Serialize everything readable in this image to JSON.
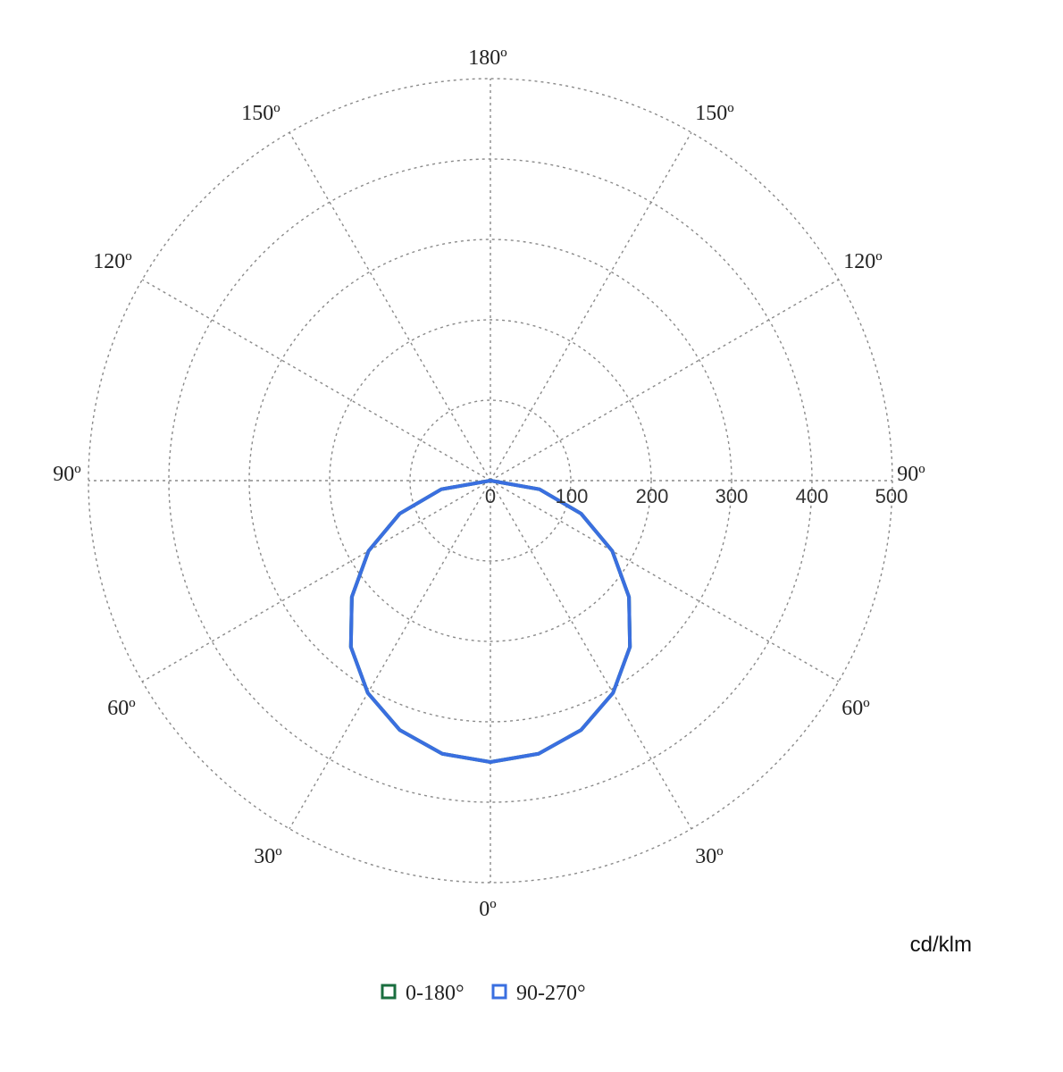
{
  "chart_data": {
    "type": "polar-line",
    "unit_label": "cd/klm",
    "radial_axis": {
      "range": [
        0,
        500
      ],
      "ticks": [
        "0",
        "100",
        "200",
        "300",
        "400",
        "500"
      ]
    },
    "angle_labels": {
      "top": "180º",
      "bottom": "0º",
      "left": "90º",
      "right": "90º",
      "left_upper": [
        "150º",
        "120º"
      ],
      "right_upper": [
        "150º",
        "120º"
      ],
      "left_lower": [
        "60º",
        "30º"
      ],
      "right_lower": [
        "60º",
        "30º"
      ]
    },
    "grid": true,
    "legend_position": "bottom-center",
    "series": [
      {
        "name": "0-180°",
        "color": "#1a6e3f",
        "angles": [
          0,
          10,
          20,
          30,
          40,
          50,
          60,
          70,
          80,
          90
        ],
        "values": [
          350,
          345,
          330,
          305,
          270,
          225,
          175,
          120,
          62,
          0
        ]
      },
      {
        "name": "90-270°",
        "color": "#3a6fe0",
        "angles": [
          0,
          10,
          20,
          30,
          40,
          50,
          60,
          70,
          80,
          90
        ],
        "values": [
          350,
          345,
          330,
          305,
          270,
          225,
          175,
          120,
          62,
          0
        ]
      }
    ]
  }
}
